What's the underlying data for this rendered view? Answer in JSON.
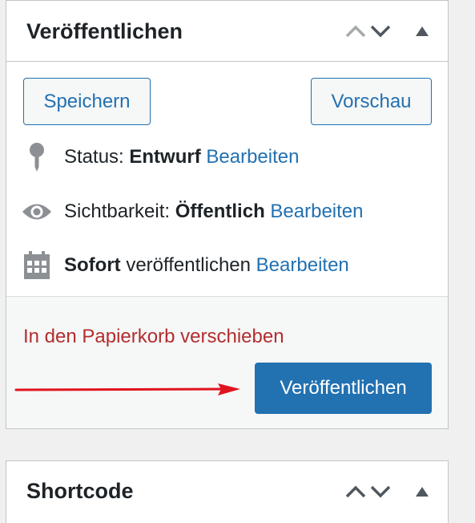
{
  "publish_box": {
    "title": "Veröffentlichen",
    "save_label": "Speichern",
    "preview_label": "Vorschau",
    "status": {
      "label": "Status:",
      "value": "Entwurf",
      "edit": "Bearbeiten",
      "icon": "pin-icon"
    },
    "visibility": {
      "label": "Sichtbarkeit:",
      "value": "Öffentlich",
      "edit": "Bearbeiten",
      "icon": "eye-icon"
    },
    "schedule": {
      "value": "Sofort",
      "label": "veröffentlichen",
      "edit": "Bearbeiten",
      "icon": "calendar-icon"
    },
    "trash_label": "In den Papierkorb verschieben",
    "publish_label": "Veröffentlichen"
  },
  "shortcode_box": {
    "title": "Shortcode"
  },
  "colors": {
    "accent": "#2271b1",
    "danger": "#b32d2e",
    "annotation": "#e0141e",
    "icon_gray": "#8c8f94"
  }
}
